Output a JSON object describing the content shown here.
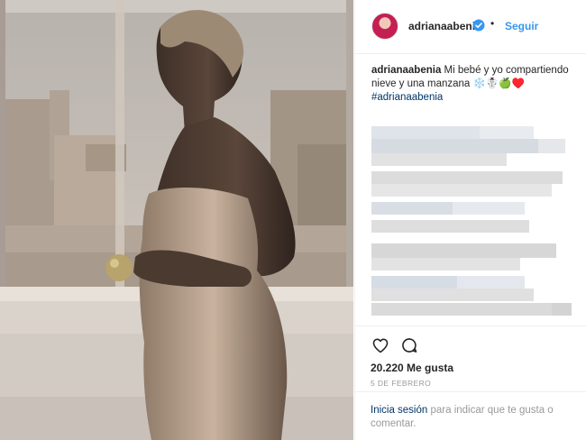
{
  "post": {
    "username": "adrianaabenia",
    "follow_label": "Seguir",
    "separator": "•",
    "verified_icon": "verified-badge-icon",
    "caption_username": "adrianaabenia",
    "caption_text": "Mi bebé y yo compartiendo nieve y una manzana ❄️☃️🍏♥️",
    "hashtag": "#adrianaabenia",
    "likes": "20.220 Me gusta",
    "date": "5 DE FEBRERO",
    "login_link": "Inicia sesión",
    "login_text": "para indicar que te gusta o comentar."
  },
  "icons": {
    "like": "heart-icon",
    "comment": "comment-icon"
  },
  "colors": {
    "link_blue": "#3897f0",
    "hashtag_blue": "#003569",
    "muted": "#999999",
    "text": "#262626"
  }
}
